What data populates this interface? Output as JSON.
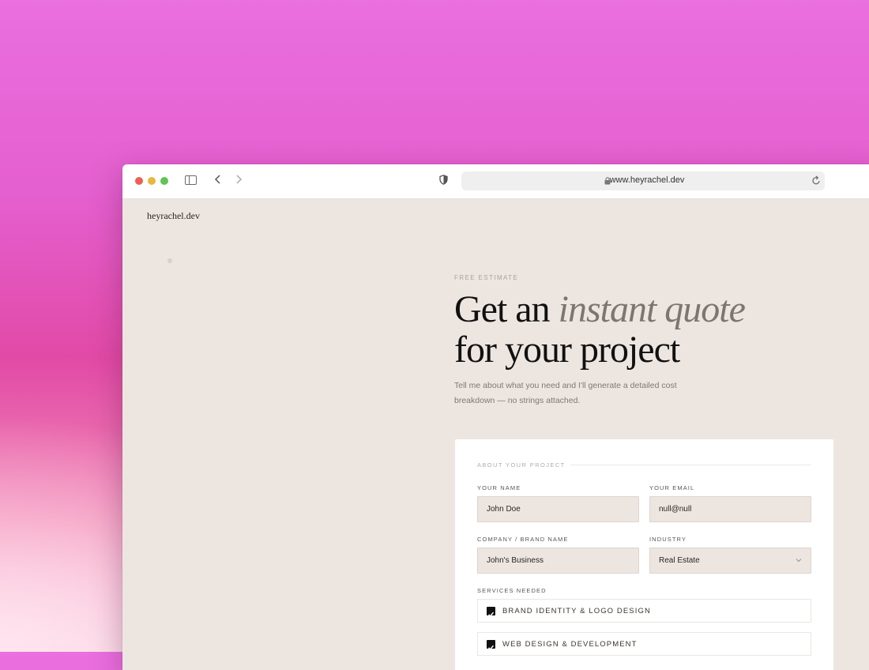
{
  "browser": {
    "url": "www.heyrachel.dev"
  },
  "site": {
    "logo": "heyrachel.dev"
  },
  "hero": {
    "eyebrow": "FREE ESTIMATE",
    "headline_part1": "Get an ",
    "headline_italic": "instant quote",
    "headline_line2": "for your project",
    "subtitle_line1": "Tell me about what you need and I'll generate a detailed cost",
    "subtitle_line2": "breakdown — no strings attached."
  },
  "form": {
    "section_label": "ABOUT YOUR PROJECT",
    "name": {
      "label": "YOUR NAME",
      "value": "John Doe"
    },
    "email": {
      "label": "YOUR EMAIL",
      "value": "null@null"
    },
    "company": {
      "label": "COMPANY / BRAND NAME",
      "value": "John's Business"
    },
    "industry": {
      "label": "INDUSTRY",
      "value": "Real Estate"
    },
    "services_label": "SERVICES NEEDED",
    "services": [
      {
        "label": "BRAND IDENTITY & LOGO DESIGN",
        "checked": true
      },
      {
        "label": "WEB DESIGN & DEVELOPMENT",
        "checked": true
      }
    ]
  },
  "icons": {
    "traffic_lights": [
      "close-icon",
      "minimize-icon",
      "zoom-icon"
    ],
    "toolbar": [
      "sidebar-icon",
      "back-arrow-icon",
      "forward-arrow-icon",
      "shield-icon",
      "lock-icon",
      "reload-icon",
      "chevron-down-icon",
      "checkmark-icon"
    ]
  },
  "colors": {
    "page_bg": "#ede6e0",
    "accent_text": "#7d7670",
    "checkbox": "#111111"
  }
}
